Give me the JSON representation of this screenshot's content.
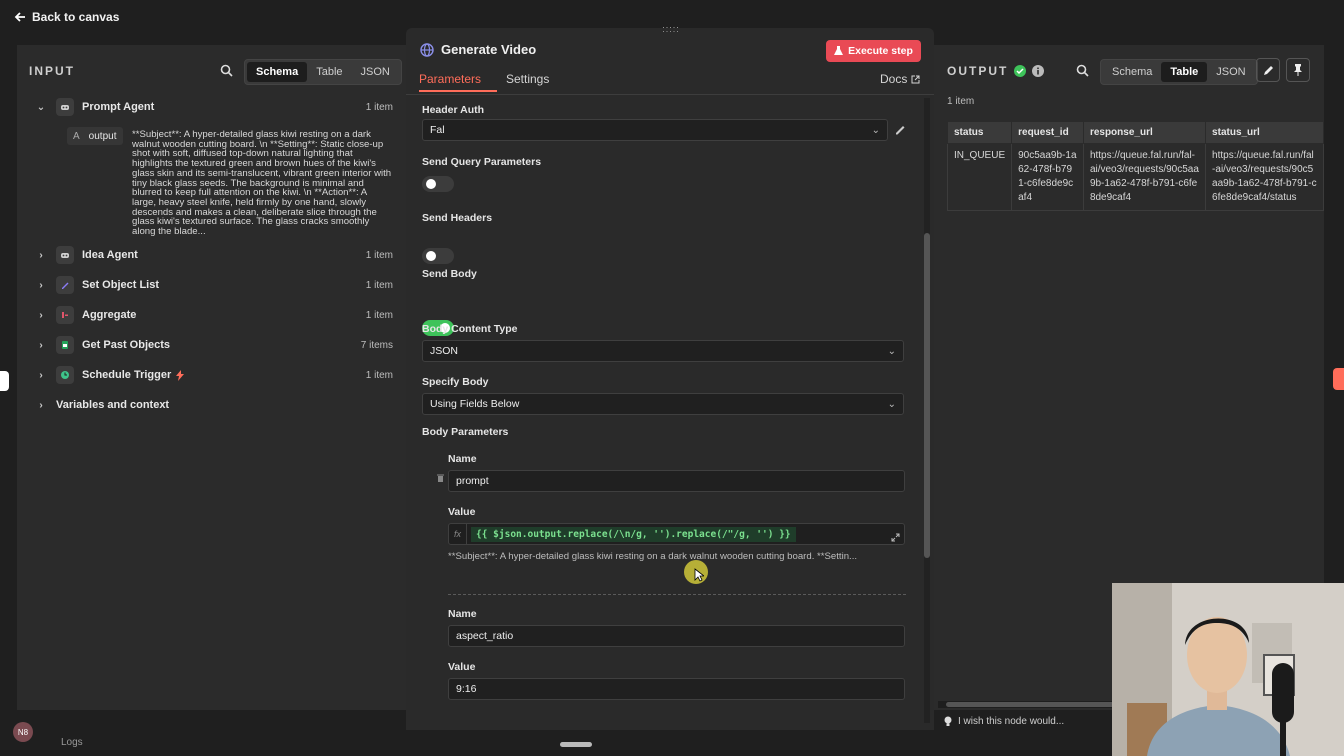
{
  "topbar": {
    "back_label": "Back to canvas"
  },
  "input_panel": {
    "title": "INPUT",
    "tabs": [
      "Schema",
      "Table",
      "JSON"
    ],
    "active_tab": "Schema",
    "expanded_item": {
      "label": "Prompt Agent",
      "count": "1 item",
      "field_type": "A",
      "field_name": "output",
      "field_value": "**Subject**: A hyper-detailed glass kiwi resting on a dark walnut wooden cutting board. \\n **Setting**: Static close-up shot with soft, diffused top-down natural lighting that highlights the textured green and brown hues of the kiwi's glass skin and its semi-translucent, vibrant green interior with tiny black glass seeds. The background is minimal and blurred to keep full attention on the kiwi. \\n **Action**: A large, heavy steel knife, held firmly by one hand, slowly descends and makes a clean, deliberate slice through the glass kiwi's textured surface. The glass cracks smoothly along the blade..."
    },
    "items": [
      {
        "label": "Idea Agent",
        "count": "1 item",
        "icon": "robot-icon",
        "color": "#cfcfcf"
      },
      {
        "label": "Set Object List",
        "count": "1 item",
        "icon": "pencil-icon",
        "color": "#8b7cf6"
      },
      {
        "label": "Aggregate",
        "count": "1 item",
        "icon": "aggregate-icon",
        "color": "#e0556b"
      },
      {
        "label": "Get Past Objects",
        "count": "7 items",
        "icon": "sheets-icon",
        "color": "#25a35a"
      },
      {
        "label": "Schedule Trigger",
        "count": "1 item",
        "icon": "clock-icon",
        "color": "#3ec38a"
      }
    ],
    "variables_label": "Variables and context"
  },
  "modal": {
    "title": "Generate Video",
    "execute_label": "Execute step",
    "tabs": [
      "Parameters",
      "Settings"
    ],
    "active_tab": "Parameters",
    "docs_label": "Docs",
    "header_auth": {
      "label": "Header Auth",
      "value": "Fal"
    },
    "send_query": {
      "label": "Send Query Parameters",
      "on": false
    },
    "send_headers": {
      "label": "Send Headers",
      "on": false
    },
    "send_body": {
      "label": "Send Body",
      "on": true
    },
    "body_content_type": {
      "label": "Body Content Type",
      "value": "JSON"
    },
    "specify_body": {
      "label": "Specify Body",
      "value": "Using Fields Below"
    },
    "body_parameters_label": "Body Parameters",
    "params": [
      {
        "name_label": "Name",
        "name": "prompt",
        "value_label": "Value",
        "value_expr": "{{ $json.output.replace(/\\n/g, '').replace(/\"/g, '') }}",
        "value_preview": "**Subject**: A hyper-detailed glass kiwi resting on a dark walnut wooden cutting board. **Settin..."
      },
      {
        "name_label": "Name",
        "name": "aspect_ratio",
        "value_label": "Value",
        "value": "9:16"
      }
    ]
  },
  "output_panel": {
    "title": "OUTPUT",
    "tabs": [
      "Schema",
      "Table",
      "JSON"
    ],
    "active_tab": "Table",
    "item_count": "1 item",
    "columns": [
      "status",
      "request_id",
      "response_url",
      "status_url"
    ],
    "row": {
      "status": "IN_QUEUE",
      "request_id": "90c5aa9b-1a62-478f-b791-c6fe8de9caf4",
      "response_url": "https://queue.fal.run/fal-ai/veo3/requests/90c5aa9b-1a62-478f-b791-c6fe8de9caf4",
      "status_url": "https://queue.fal.run/fal-ai/veo3/requests/90c5aa9b-1a62-478f-b791-c6fe8de9caf4/status"
    },
    "feedback_label": "I wish this node would..."
  },
  "footer": {
    "logs_label": "Logs"
  },
  "colors": {
    "accent": "#ff6d5a",
    "execute_bg": "#e94a55",
    "green": "#3ec35a"
  }
}
